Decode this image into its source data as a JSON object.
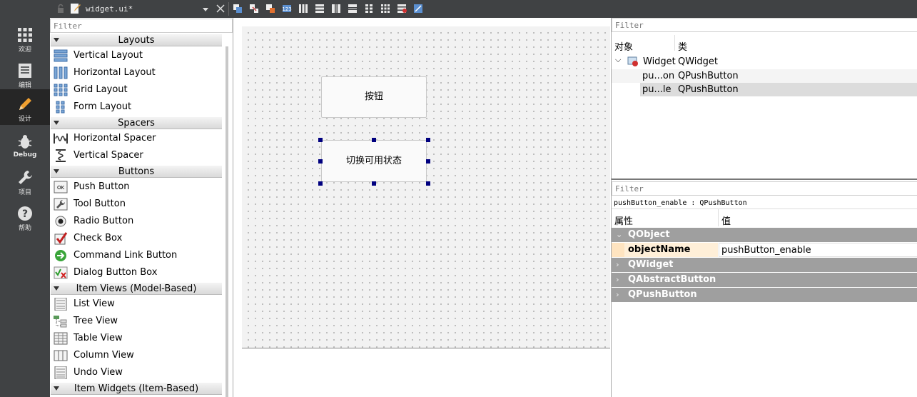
{
  "modes": [
    {
      "name": "welcome",
      "label": "欢迎",
      "icon": "grid-icon"
    },
    {
      "name": "edit",
      "label": "编辑",
      "icon": "document-icon"
    },
    {
      "name": "design",
      "label": "设计",
      "icon": "pencil-icon",
      "active": true
    },
    {
      "name": "debug",
      "label": "Debug",
      "icon": "bug-icon"
    },
    {
      "name": "projects",
      "label": "项目",
      "icon": "wrench-icon"
    },
    {
      "name": "help",
      "label": "帮助",
      "icon": "question-icon"
    }
  ],
  "toolbar": {
    "file_name": "widget.ui*"
  },
  "widget_box": {
    "filter_placeholder": "Filter",
    "categories": {
      "layouts": "Layouts",
      "spacers": "Spacers",
      "buttons": "Buttons",
      "item_views": "Item Views (Model-Based)",
      "item_widgets": "Item Widgets (Item-Based)"
    },
    "items": {
      "vertical_layout": "Vertical Layout",
      "horizontal_layout": "Horizontal Layout",
      "grid_layout": "Grid Layout",
      "form_layout": "Form Layout",
      "horizontal_spacer": "Horizontal Spacer",
      "vertical_spacer": "Vertical Spacer",
      "push_button": "Push Button",
      "tool_button": "Tool Button",
      "radio_button": "Radio Button",
      "check_box": "Check Box",
      "command_link_button": "Command Link Button",
      "dialog_button_box": "Dialog Button Box",
      "list_view": "List View",
      "tree_view": "Tree View",
      "table_view": "Table View",
      "column_view": "Column View",
      "undo_view": "Undo View"
    }
  },
  "form": {
    "button1_text": "按钮",
    "button2_text": "切换可用状态"
  },
  "object_inspector": {
    "filter_placeholder": "Filter",
    "col_object": "对象",
    "col_class": "类",
    "rows": [
      {
        "object": "Widget",
        "class": "QWidget"
      },
      {
        "object": "pu...on",
        "class": "QPushButton"
      },
      {
        "object": "pu...le",
        "class": "QPushButton"
      }
    ]
  },
  "property_editor": {
    "filter_placeholder": "Filter",
    "current_object": "pushButton_enable : QPushButton",
    "col_property": "属性",
    "col_value": "值",
    "groups": {
      "qobject": "QObject",
      "qwidget": "QWidget",
      "qabstractbutton": "QAbstractButton",
      "qpushbutton": "QPushButton"
    },
    "object_name_label": "objectName",
    "object_name_value": "pushButton_enable"
  },
  "colors": {
    "sidebar_bg": "#404244",
    "active_mode_bg": "#262626",
    "group_header_bg": "#9f9f9f",
    "selection_handle": "#00007f"
  }
}
